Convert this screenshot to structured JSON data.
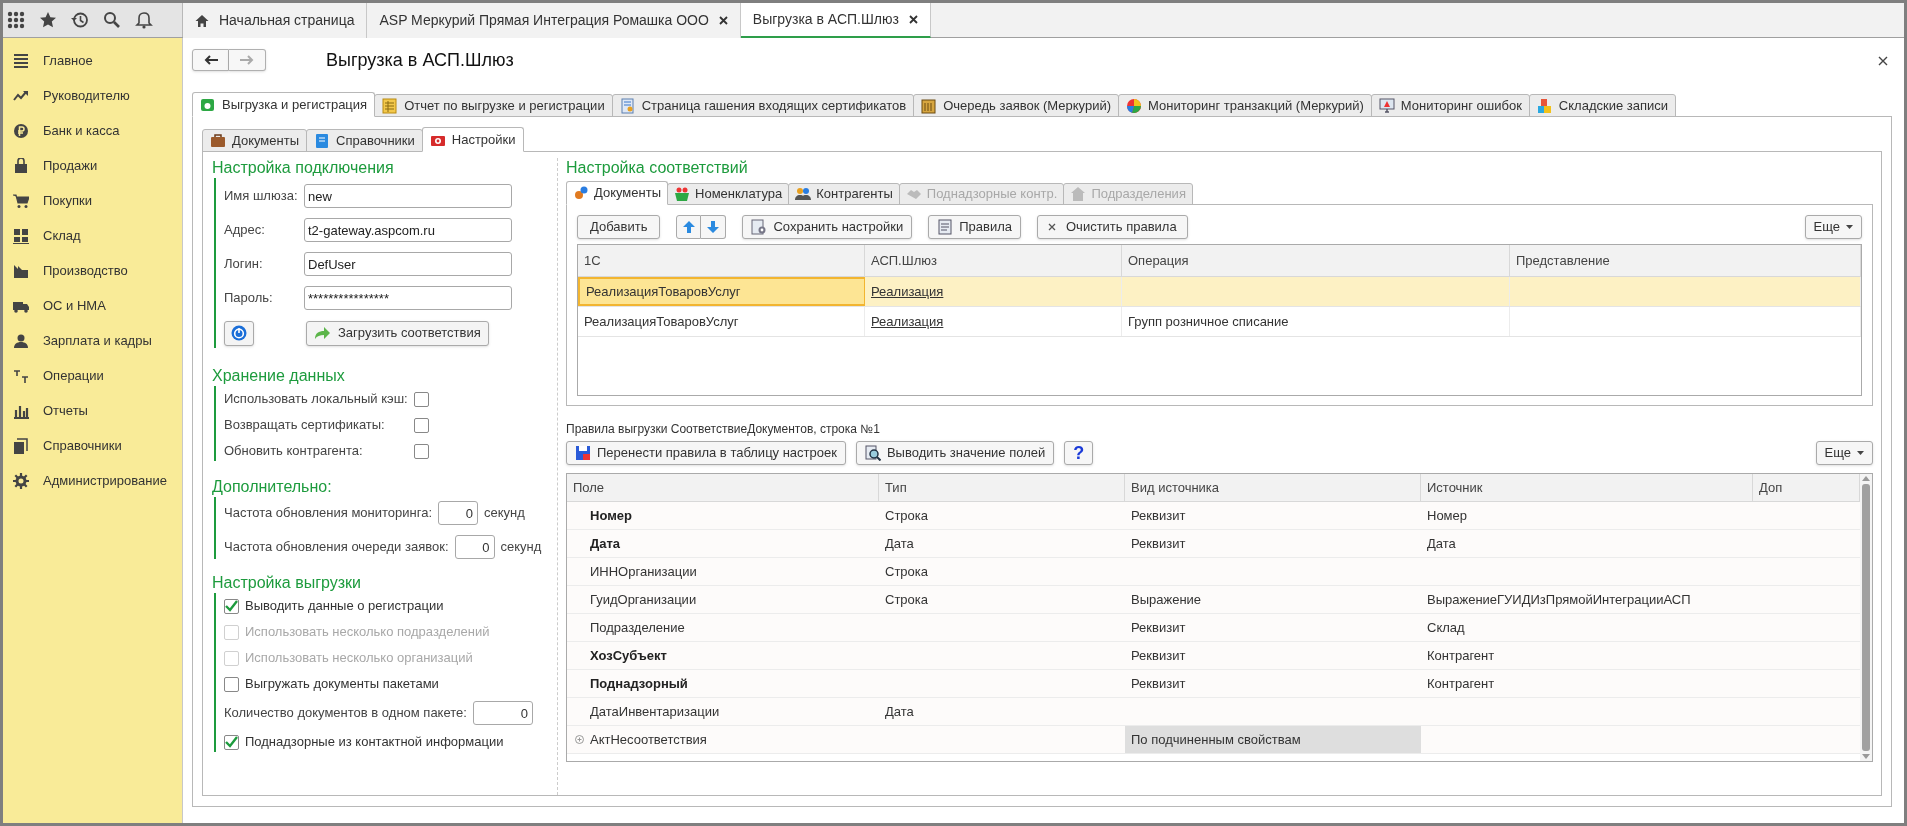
{
  "top_tabs": [
    {
      "label": "Начальная страница",
      "selected": false,
      "closable": false
    },
    {
      "label": "ASP Меркурий Прямая Интеграция Ромашка ООО",
      "selected": false,
      "closable": true
    },
    {
      "label": "Выгрузка в АСП.Шлюз",
      "selected": true,
      "closable": true
    }
  ],
  "sidebar": {
    "items": [
      {
        "label": "Главное"
      },
      {
        "label": "Руководителю"
      },
      {
        "label": "Банк и касса"
      },
      {
        "label": "Продажи"
      },
      {
        "label": "Покупки"
      },
      {
        "label": "Склад"
      },
      {
        "label": "Производство"
      },
      {
        "label": "ОС и НМА"
      },
      {
        "label": "Зарплата и кадры"
      },
      {
        "label": "Операции"
      },
      {
        "label": "Отчеты"
      },
      {
        "label": "Справочники"
      },
      {
        "label": "Администрирование"
      }
    ]
  },
  "page": {
    "title": "Выгрузка в АСП.Шлюз"
  },
  "main_tabs": [
    {
      "label": "Выгрузка и регистрация",
      "selected": true
    },
    {
      "label": "Отчет по выгрузке и регистрации",
      "selected": false
    },
    {
      "label": "Страница гашения входящих сертификатов",
      "selected": false
    },
    {
      "label": "Очередь заявок (Меркурий)",
      "selected": false
    },
    {
      "label": "Мониторинг транзакций (Меркурий)",
      "selected": false
    },
    {
      "label": "Мониторинг ошибок",
      "selected": false
    },
    {
      "label": "Складские записи",
      "selected": false
    }
  ],
  "sub_tabs": [
    {
      "label": "Документы",
      "selected": false
    },
    {
      "label": "Справочники",
      "selected": false
    },
    {
      "label": "Настройки",
      "selected": true
    }
  ],
  "connection": {
    "heading": "Настройка подключения",
    "fields": [
      {
        "label": "Имя шлюза:",
        "value": "new"
      },
      {
        "label": "Адрес:",
        "value": "t2-gateway.aspcom.ru"
      },
      {
        "label": "Логин:",
        "value": "DefUser"
      },
      {
        "label": "Пароль:",
        "value": "****************"
      }
    ],
    "load_button": "Загрузить соответствия"
  },
  "storage": {
    "heading": "Хранение данных",
    "options": [
      {
        "label": "Использовать локальный кэш:",
        "checked": false
      },
      {
        "label": "Возвращать сертификаты:",
        "checked": false
      },
      {
        "label": "Обновить контрагента:",
        "checked": false
      }
    ]
  },
  "additional": {
    "heading": "Дополнительно:",
    "fields": [
      {
        "label": "Частота обновления мониторинга:",
        "value": "0",
        "unit": "секунд"
      },
      {
        "label": "Частота обновления очереди заявок:",
        "value": "0",
        "unit": "секунд"
      }
    ]
  },
  "export": {
    "heading": "Настройка выгрузки",
    "items": [
      {
        "kind": "checkbox",
        "label": "Выводить данные о регистрации",
        "checked": true,
        "disabled": false
      },
      {
        "kind": "checkbox",
        "label": "Использовать несколько подразделений",
        "checked": false,
        "disabled": true
      },
      {
        "kind": "checkbox",
        "label": "Использовать несколько организаций",
        "checked": false,
        "disabled": true
      },
      {
        "kind": "checkbox",
        "label": "Выгружать документы пакетами",
        "checked": false,
        "disabled": false
      },
      {
        "kind": "number",
        "label": "Количество документов в одном пакете:",
        "value": "0"
      },
      {
        "kind": "checkbox",
        "label": "Поднадзорные из контактной информации",
        "checked": true,
        "disabled": false
      }
    ]
  },
  "mapping": {
    "heading": "Настройка соответствий",
    "tabs": [
      {
        "label": "Документы",
        "selected": true,
        "disabled": false
      },
      {
        "label": "Номенклатура",
        "selected": false,
        "disabled": false
      },
      {
        "label": "Контрагенты",
        "selected": false,
        "disabled": false
      },
      {
        "label": "Поднадзорные контр.",
        "selected": false,
        "disabled": true
      },
      {
        "label": "Подразделения",
        "selected": false,
        "disabled": true
      }
    ],
    "toolbar": {
      "add": "Добавить",
      "save": "Сохранить настройки",
      "rules": "Правила",
      "clear": "Очистить правила",
      "more": "Еще"
    },
    "table": {
      "columns": [
        "1С",
        "АСП.Шлюз",
        "Операция",
        "Представление"
      ],
      "rows": [
        {
          "cells": [
            "РеализацияТоваровУслуг",
            "Реализация",
            "",
            ""
          ],
          "selected": true
        },
        {
          "cells": [
            "РеализацияТоваровУслуг",
            "Реализация",
            "Групп розничное списание",
            ""
          ],
          "selected": false
        }
      ]
    }
  },
  "rules": {
    "caption": "Правила выгрузки СоответствиеДокументов, строка №1",
    "toolbar": {
      "move": "Перенести правила в таблицу настроек",
      "show": "Выводить значение полей",
      "help": "?",
      "more": "Еще"
    },
    "table": {
      "columns": [
        "Поле",
        "Тип",
        "Вид источника",
        "Источник",
        "Доп"
      ],
      "rows": [
        {
          "cells": [
            "Номер",
            "Строка",
            "Реквизит",
            "Номер",
            ""
          ],
          "bold": true,
          "expandable": false
        },
        {
          "cells": [
            "Дата",
            "Дата",
            "Реквизит",
            "Дата",
            ""
          ],
          "bold": true,
          "expandable": false
        },
        {
          "cells": [
            "ИННОрганизации",
            "Строка",
            "",
            "",
            ""
          ],
          "bold": false,
          "expandable": false
        },
        {
          "cells": [
            "ГуидОрганизации",
            "Строка",
            "Выражение",
            "ВыражениеГУИДИзПрямойИнтеграцииАСП",
            ""
          ],
          "bold": false,
          "expandable": false
        },
        {
          "cells": [
            "Подразделение",
            "",
            "Реквизит",
            "Склад",
            ""
          ],
          "bold": false,
          "expandable": false
        },
        {
          "cells": [
            "ХозСубъект",
            "",
            "Реквизит",
            "Контрагент",
            ""
          ],
          "bold": true,
          "expandable": false
        },
        {
          "cells": [
            "Поднадзорный",
            "",
            "Реквизит",
            "Контрагент",
            ""
          ],
          "bold": true,
          "expandable": false
        },
        {
          "cells": [
            "ДатаИнвентаризации",
            "Дата",
            "",
            "",
            ""
          ],
          "bold": false,
          "expandable": false
        },
        {
          "cells": [
            "АктНесоответствия",
            "",
            "По подчиненным свойствам",
            "",
            ""
          ],
          "bold": false,
          "expandable": true
        }
      ]
    }
  }
}
